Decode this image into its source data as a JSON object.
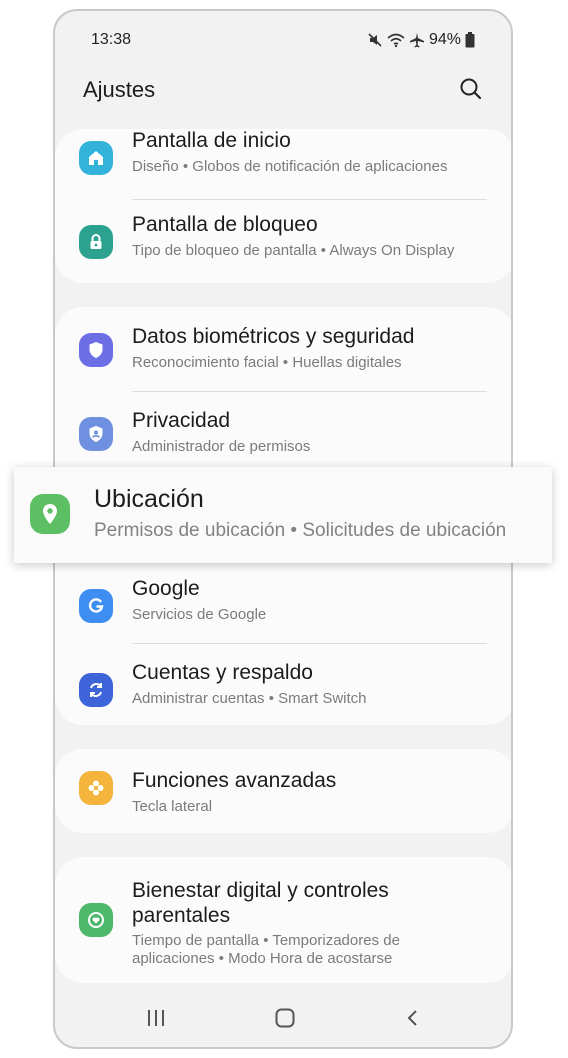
{
  "status": {
    "time": "13:38",
    "battery": "94%"
  },
  "header": {
    "title": "Ajustes"
  },
  "items": {
    "home_screen": {
      "title": "Pantalla de inicio",
      "subtitle": "Diseño  •  Globos de notificación de aplicaciones",
      "icon": "home-icon",
      "color": "#33b3d9"
    },
    "lock_screen": {
      "title": "Pantalla de bloqueo",
      "subtitle": "Tipo de bloqueo de pantalla  •  Always On Display",
      "icon": "lock-icon",
      "color": "#2aa28f"
    },
    "biometrics": {
      "title": "Datos biométricos y seguridad",
      "subtitle": "Reconocimiento facial  •  Huellas digitales",
      "icon": "shield-icon",
      "color": "#6c6ee6"
    },
    "privacy": {
      "title": "Privacidad",
      "subtitle": "Administrador de permisos",
      "icon": "privacy-shield-icon",
      "color": "#6f8fe0"
    },
    "location": {
      "title": "Ubicación",
      "subtitle": "Permisos de ubicación  •  Solicitudes de ubicación",
      "icon": "location-pin-icon",
      "color": "#5cbf63"
    },
    "google": {
      "title": "Google",
      "subtitle": "Servicios de Google",
      "icon": "google-icon",
      "color": "#3d8ef0"
    },
    "accounts": {
      "title": "Cuentas y respaldo",
      "subtitle": "Administrar cuentas  •  Smart Switch",
      "icon": "sync-icon",
      "color": "#3d64d8"
    },
    "advanced": {
      "title": "Funciones avanzadas",
      "subtitle": "Tecla lateral",
      "icon": "gear-flower-icon",
      "color": "#f5b43c"
    },
    "wellbeing": {
      "title_line1": "Bienestar digital y controles",
      "title_line2": "parentales",
      "subtitle_line1": "Tiempo de pantalla  •  Temporizadores de",
      "subtitle_line2": "aplicaciones  •  Modo Hora de acostarse",
      "icon": "wellbeing-heart-icon",
      "color": "#4db86a"
    }
  },
  "nav": {
    "recents": "recents-icon",
    "home": "home-nav-icon",
    "back": "back-icon"
  }
}
